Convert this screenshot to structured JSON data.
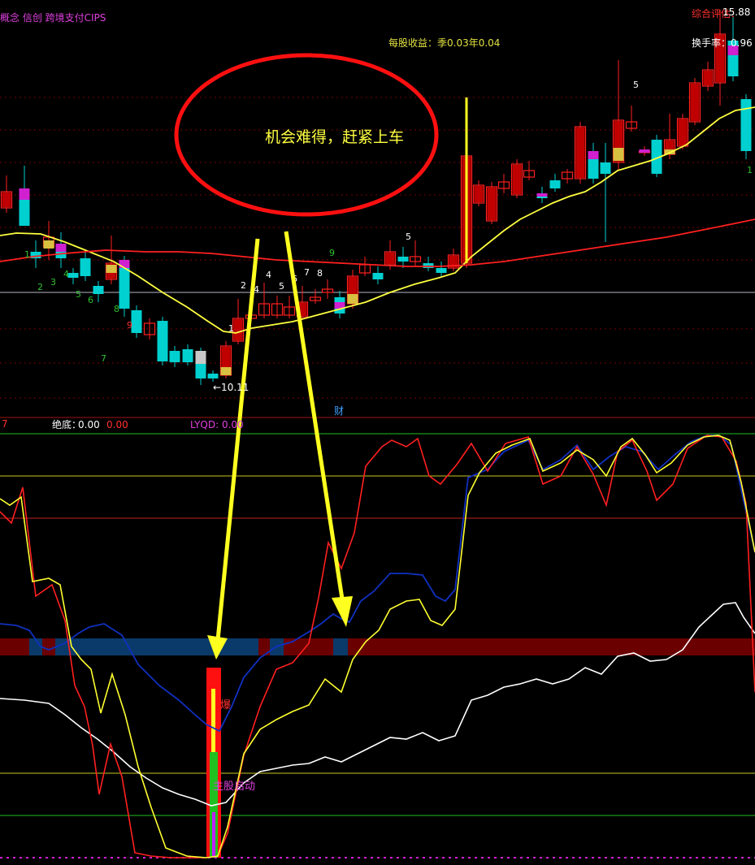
{
  "header": {
    "concept_tags": "概念 信创 跨境支付CIPS",
    "eps_label": "每股收益：季0.03年0.04",
    "rating_label": "综合评估：",
    "rating_value": "15.88",
    "turnover_label": "换手率：0.96"
  },
  "annotation": {
    "text": "机会难得，赶紧上车"
  },
  "indicator_header": {
    "left_value": "7",
    "juedi_label": "绝底：",
    "juedi_value1": "0.00",
    "juedi_value2": "0.00",
    "lyqd_label": "LYQD: 0.00",
    "cai_tag": "财"
  },
  "signal_labels": {
    "bao": "爆",
    "start": "主股启动"
  },
  "colors": {
    "up": "#ff2020",
    "down": "#00d0d0",
    "ma_fast": "#ffff40",
    "ma_slow": "#ff2020",
    "annotation_ring": "#ff1010",
    "arrow": "#ffff20",
    "purple": "#d020d0"
  },
  "chart_data": [
    {
      "type": "candlestick",
      "low_marker": "←10.11",
      "seq_labels": [
        {
          "text": "1",
          "color": "#30c030"
        },
        {
          "text": "2",
          "color": "#30c030"
        },
        {
          "text": "3",
          "color": "#30c030"
        },
        {
          "text": "4",
          "color": "#30c030"
        },
        {
          "text": "5",
          "color": "#30c030"
        },
        {
          "text": "6",
          "color": "#30c030"
        },
        {
          "text": "7",
          "color": "#30c030"
        },
        {
          "text": "8",
          "color": "#30c030"
        },
        {
          "text": "9",
          "color": "#ff3030"
        },
        {
          "text": "1",
          "color": "#ffffff"
        },
        {
          "text": "2",
          "color": "#ffffff"
        },
        {
          "text": "4",
          "color": "#ffffff"
        },
        {
          "text": "5",
          "color": "#ffffff"
        },
        {
          "text": "6",
          "color": "#ffffff"
        },
        {
          "text": "7",
          "color": "#ffffff"
        },
        {
          "text": "8",
          "color": "#ffffff"
        },
        {
          "text": "9",
          "color": "#30c030"
        },
        {
          "text": "5",
          "color": "#ffffff"
        },
        {
          "text": "5",
          "color": "#ffffff"
        },
        {
          "text": "1",
          "color": "#30c030"
        }
      ]
    },
    {
      "type": "line",
      "series": [
        {
          "color": "#ff2020"
        },
        {
          "color": "#ffff30"
        },
        {
          "color": "#1030c0"
        },
        {
          "color": "#ffffff"
        }
      ]
    }
  ]
}
